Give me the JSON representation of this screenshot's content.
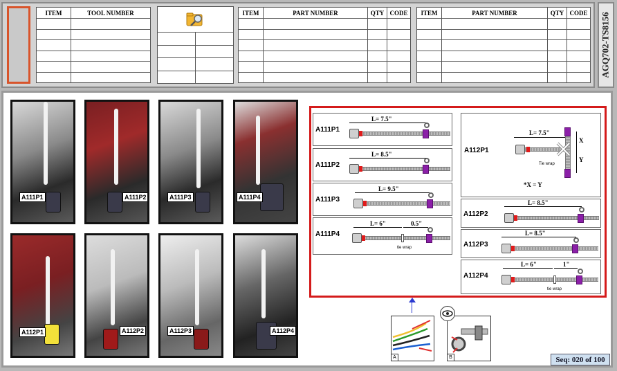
{
  "header": {
    "tool_table": {
      "headers": [
        "ITEM",
        "TOOL NUMBER"
      ],
      "rows": 6
    },
    "part_table_1": {
      "headers": [
        "ITEM",
        "PART NUMBER",
        "QTY",
        "CODE"
      ],
      "rows": 6
    },
    "part_table_2": {
      "headers": [
        "ITEM",
        "PART NUMBER",
        "QTY",
        "CODE"
      ],
      "rows": 6
    },
    "doc_id": "AGQ702-TS8156",
    "icon": "magnifier-folder-icon"
  },
  "photos": [
    {
      "label": "A111P1"
    },
    {
      "label": "A111P2"
    },
    {
      "label": "A111P3"
    },
    {
      "label": "A111P4"
    },
    {
      "label": "A112P1"
    },
    {
      "label": "A112P2"
    },
    {
      "label": "A112P3"
    },
    {
      "label": "A112P4"
    }
  ],
  "diagrams": {
    "a111p1": {
      "name": "A111P1",
      "length": "L= 7.5\""
    },
    "a111p2": {
      "name": "A111P2",
      "length": "L= 8.5\""
    },
    "a111p3": {
      "name": "A111P3",
      "length": "L= 9.5\""
    },
    "a111p4": {
      "name": "A111P4",
      "length": "L= 6\"",
      "offset": "0.5\"",
      "note": "tie wrap"
    },
    "a112p1": {
      "name": "A112P1",
      "length": "L= 7.5\"",
      "x_label": "X",
      "y_label": "Y",
      "note": "Tie wrap",
      "equation": "*X = Y"
    },
    "a112p2": {
      "name": "A112P2",
      "length": "L= 8.5\""
    },
    "a112p3": {
      "name": "A112P3",
      "length": "L= 8.5\""
    },
    "a112p4": {
      "name": "A112P4",
      "length": "L= 6\"",
      "offset": "1\"",
      "note": "tie wrap"
    }
  },
  "thumbs": {
    "a": "A",
    "b": "B"
  },
  "colors": {
    "frame_red": "#d41b1b",
    "tube_purple": "#8b1fa8",
    "swatch_orange": "#d8542b"
  },
  "sequence": "Seq: 020 of 100"
}
